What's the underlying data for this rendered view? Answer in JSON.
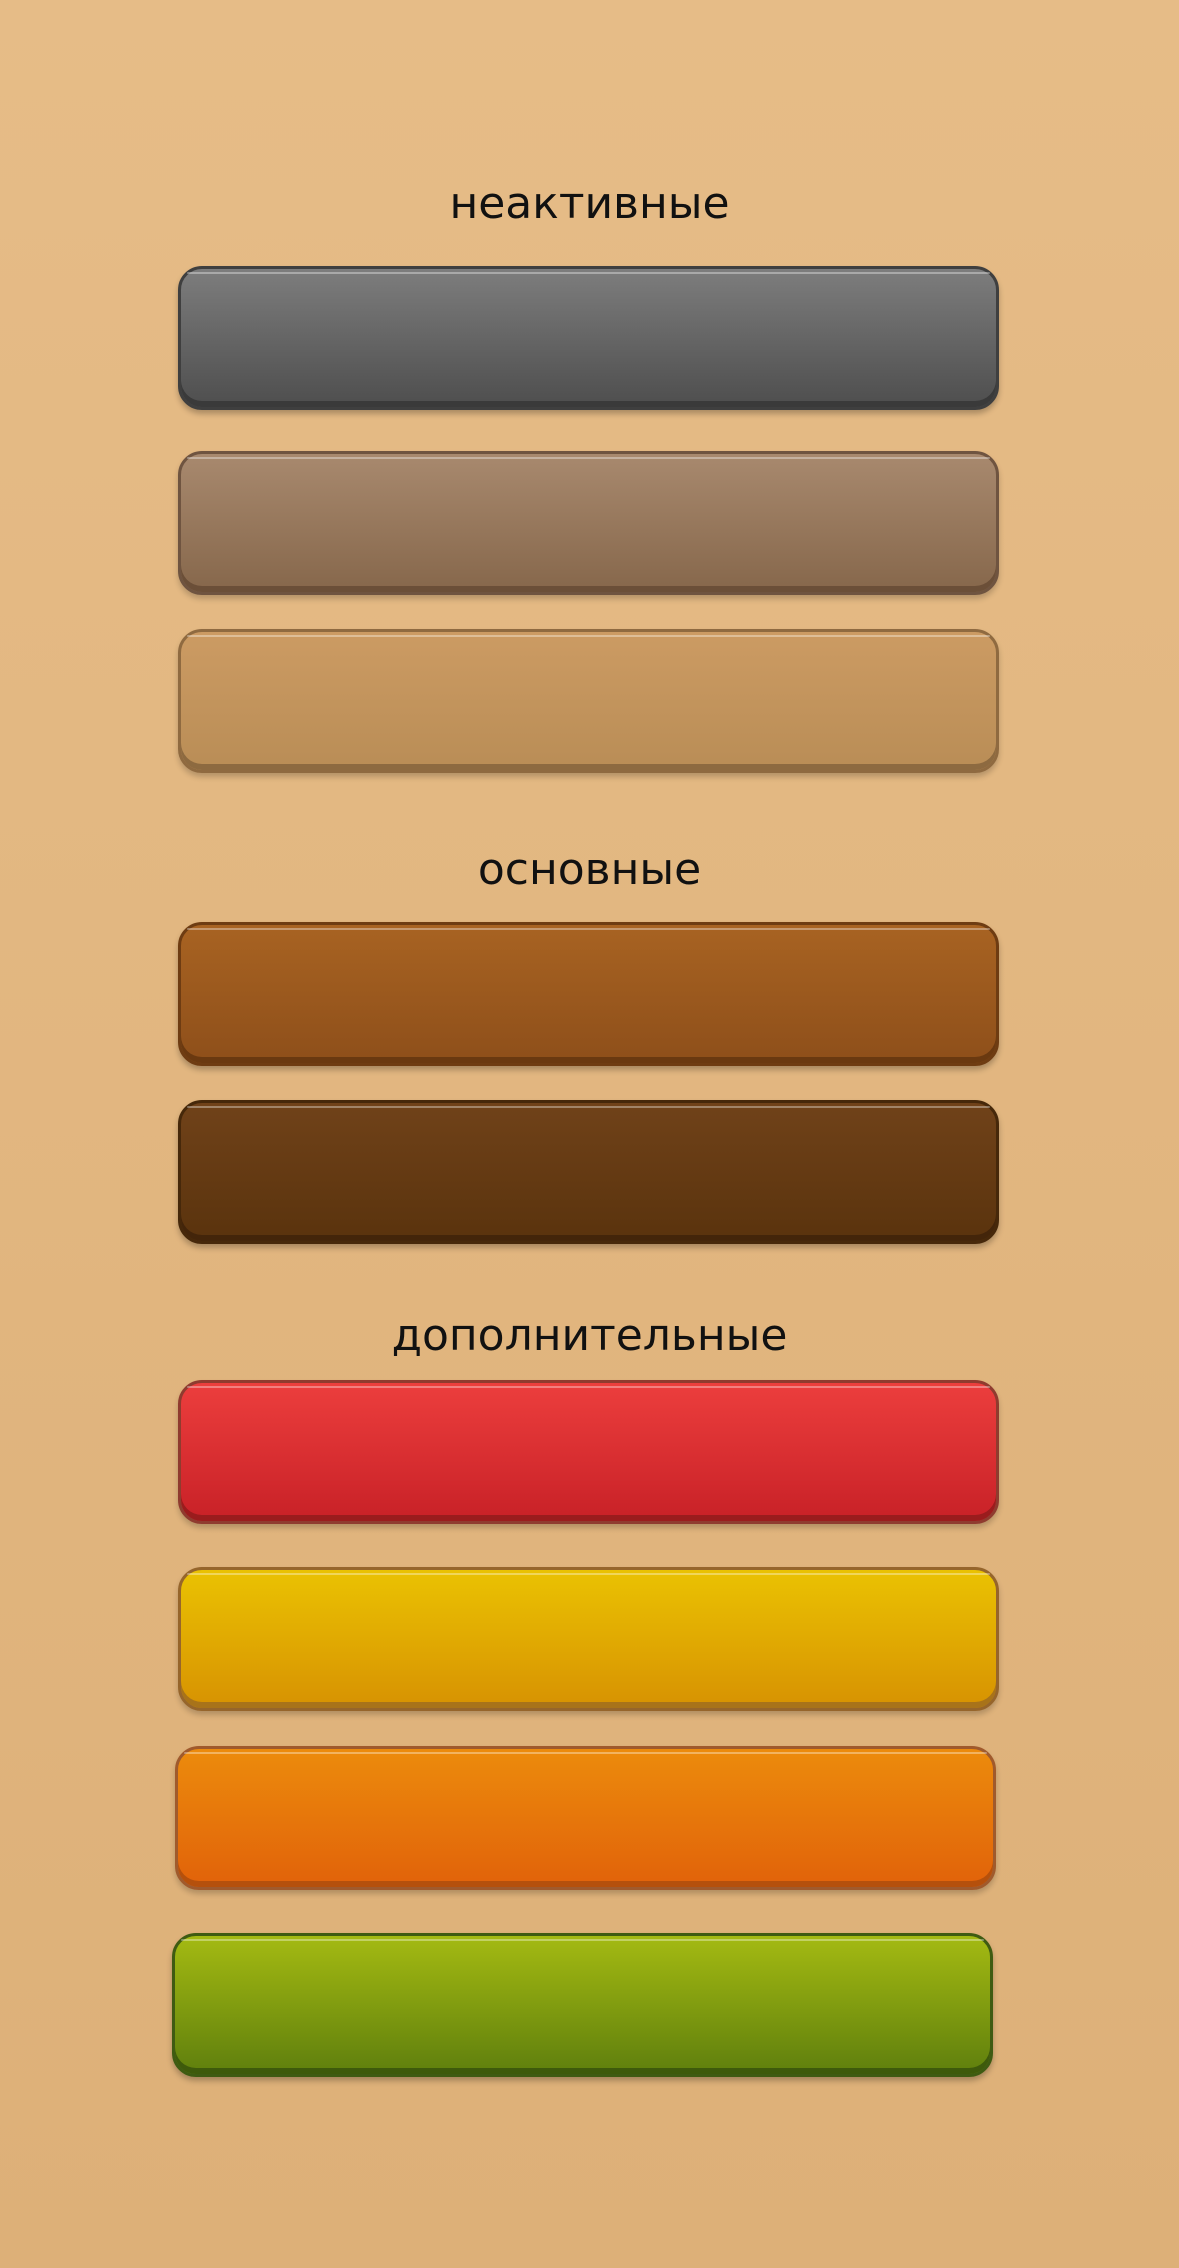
{
  "sections": {
    "inactive": {
      "title": "неактивные",
      "buttons": [
        {
          "name": "gray",
          "color": "#666666"
        },
        {
          "name": "mocha",
          "color": "#977659"
        },
        {
          "name": "tan",
          "color": "#c2955c"
        }
      ]
    },
    "primary": {
      "title": "основные",
      "buttons": [
        {
          "name": "amber",
          "color": "#9b591e"
        },
        {
          "name": "chocolate",
          "color": "#653a13"
        }
      ]
    },
    "additional": {
      "title": "дополнительные",
      "buttons": [
        {
          "name": "red",
          "color": "#dc3034"
        },
        {
          "name": "yellow",
          "color": "#e2aa02"
        },
        {
          "name": "orange",
          "color": "#e7760b"
        },
        {
          "name": "green",
          "color": "#82a010"
        }
      ]
    }
  },
  "colors": {
    "background": "#e2b680",
    "title_text": "#111111"
  }
}
